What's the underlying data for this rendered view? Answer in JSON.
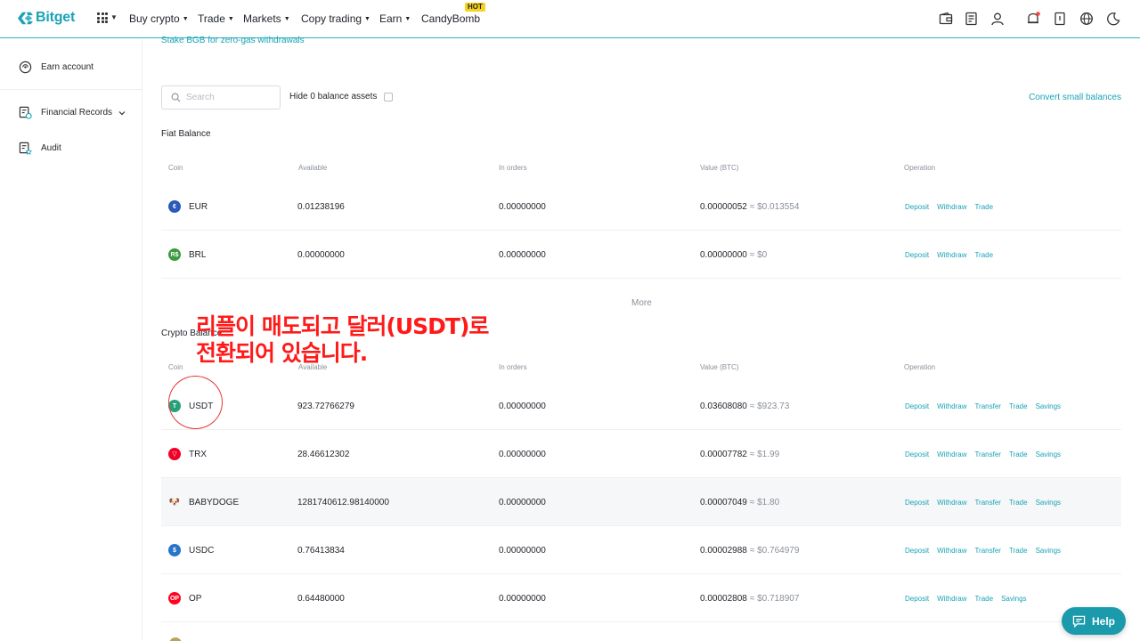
{
  "brand": {
    "name": "Bitget",
    "color": "#1aa3b5"
  },
  "nav": {
    "items": [
      {
        "label": "Buy crypto",
        "has_caret": true
      },
      {
        "label": "Trade",
        "has_caret": true
      },
      {
        "label": "Markets",
        "has_caret": true
      },
      {
        "label": "Copy trading",
        "has_caret": true
      },
      {
        "label": "Earn",
        "has_caret": true
      },
      {
        "label": "CandyBomb",
        "has_caret": false
      }
    ],
    "hot_badge": "HOT",
    "right_icons": [
      "wallet-icon",
      "orders-icon",
      "user-icon",
      "bell-icon",
      "download-icon",
      "globe-icon",
      "moon-icon"
    ]
  },
  "sidebar": {
    "items": [
      {
        "label": "Earn account",
        "icon": "earn-icon"
      },
      {
        "label": "Financial Records",
        "icon": "records-icon"
      },
      {
        "label": "Audit",
        "icon": "audit-icon"
      }
    ]
  },
  "main": {
    "stake_link": "Stake BGB for zero-gas withdrawals",
    "search_placeholder": "Search",
    "hide_zero_label": "Hide 0 balance assets",
    "convert_link": "Convert small balances",
    "more_label": "More"
  },
  "fiat": {
    "title": "Fiat Balance",
    "columns": [
      "Coin",
      "Available",
      "In orders",
      "Value (BTC)",
      "Operation"
    ],
    "rows": [
      {
        "coin": "EUR",
        "icon_color": "#2a5ab8",
        "icon_text": "€",
        "available": "0.01238196",
        "in_orders": "0.00000000",
        "value_btc": "0.00000052",
        "value_usd": "≈ $0.013554",
        "ops": [
          "Deposit",
          "Withdraw",
          "Trade"
        ]
      },
      {
        "coin": "BRL",
        "icon_color": "#3c9a41",
        "icon_text": "R$",
        "available": "0.00000000",
        "in_orders": "0.00000000",
        "value_btc": "0.00000000",
        "value_usd": "≈ $0",
        "ops": [
          "Deposit",
          "Withdraw",
          "Trade"
        ]
      }
    ]
  },
  "crypto": {
    "title": "Crypto Balance",
    "columns": [
      "Coin",
      "Available",
      "In orders",
      "Value (BTC)",
      "Operation"
    ],
    "rows": [
      {
        "coin": "USDT",
        "icon_color": "#26a17b",
        "icon_text": "T",
        "available": "923.72766279",
        "in_orders": "0.00000000",
        "value_btc": "0.03608080",
        "value_usd": "≈ $923.73",
        "ops": [
          "Deposit",
          "Withdraw",
          "Transfer",
          "Trade",
          "Savings"
        ]
      },
      {
        "coin": "TRX",
        "icon_color": "#ef0027",
        "icon_text": "▽",
        "available": "28.46612302",
        "in_orders": "0.00000000",
        "value_btc": "0.00007782",
        "value_usd": "≈ $1.99",
        "ops": [
          "Deposit",
          "Withdraw",
          "Transfer",
          "Trade",
          "Savings"
        ]
      },
      {
        "coin": "BABYDOGE",
        "icon_color": "#c98a3e",
        "icon_text": "🐶",
        "available": "1281740612.98140000",
        "in_orders": "0.00000000",
        "value_btc": "0.00007049",
        "value_usd": "≈ $1.80",
        "ops": [
          "Deposit",
          "Withdraw",
          "Transfer",
          "Trade",
          "Savings"
        ]
      },
      {
        "coin": "USDC",
        "icon_color": "#2775ca",
        "icon_text": "$",
        "available": "0.76413834",
        "in_orders": "0.00000000",
        "value_btc": "0.00002988",
        "value_usd": "≈ $0.764979",
        "ops": [
          "Deposit",
          "Withdraw",
          "Transfer",
          "Trade",
          "Savings"
        ]
      },
      {
        "coin": "OP",
        "icon_color": "#ff0420",
        "icon_text": "OP",
        "available": "0.64480000",
        "in_orders": "0.00000000",
        "value_btc": "0.00002808",
        "value_usd": "≈ $0.718907",
        "ops": [
          "Deposit",
          "Withdraw",
          "Trade",
          "Savings"
        ]
      }
    ]
  },
  "annotation": {
    "text": "리플이 매도되고 달러(USDT)로\n전환되어 있습니다.",
    "color": "#ff1a1a"
  },
  "help": {
    "label": "Help"
  }
}
